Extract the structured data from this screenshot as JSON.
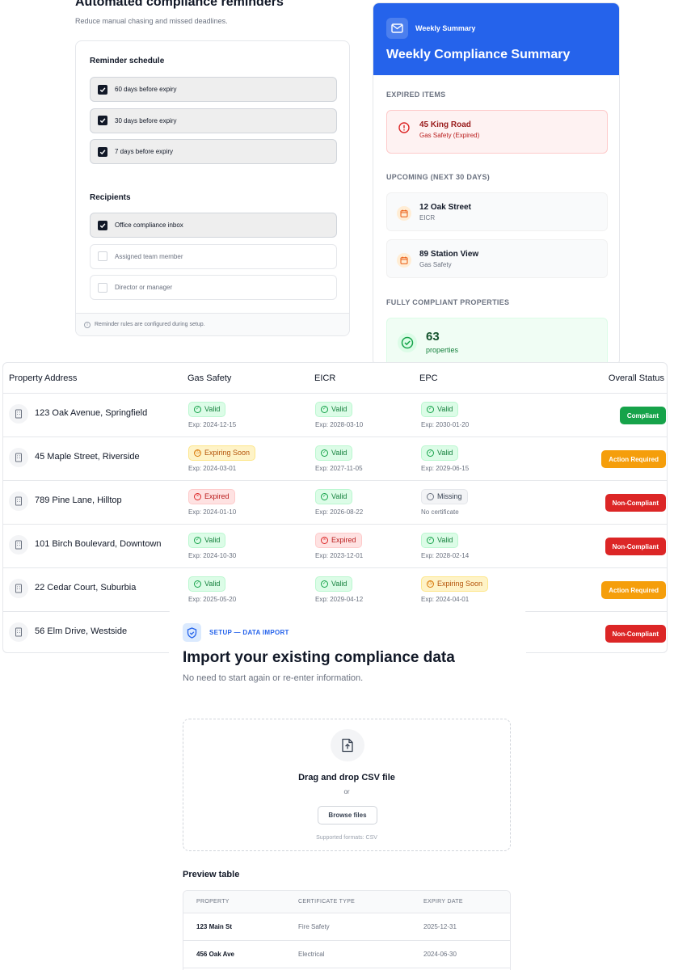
{
  "reminders": {
    "title": "Automated compliance reminders",
    "subtitle": "Reduce manual chasing and missed deadlines.",
    "schedule_heading": "Reminder schedule",
    "schedule": [
      {
        "label": "60 days before expiry",
        "checked": true
      },
      {
        "label": "30 days before expiry",
        "checked": true
      },
      {
        "label": "7 days before expiry",
        "checked": true
      }
    ],
    "recipients_heading": "Recipients",
    "recipients": [
      {
        "label": "Office compliance inbox",
        "checked": true
      },
      {
        "label": "Assigned team member",
        "checked": false
      },
      {
        "label": "Director or manager",
        "checked": false
      }
    ],
    "footer_note": "Reminder rules are configured during setup."
  },
  "summary": {
    "badge_label": "Weekly Summary",
    "title": "Weekly Compliance Summary",
    "accent_color": "#2563eb",
    "expired_heading": "EXPIRED ITEMS",
    "expired": {
      "title": "45 King Road",
      "detail": "Gas Safety (Expired)"
    },
    "upcoming_heading": "UPCOMING (NEXT 30 DAYS)",
    "upcoming": [
      {
        "title": "12 Oak Street",
        "detail": "EICR"
      },
      {
        "title": "89 Station View",
        "detail": "Gas Safety"
      }
    ],
    "compliant_heading": "FULLY COMPLIANT PROPERTIES",
    "compliant_count": "63",
    "compliant_unit": "properties"
  },
  "table": {
    "headers": {
      "address": "Property Address",
      "gas": "Gas Safety",
      "eicr": "EICR",
      "epc": "EPC",
      "status": "Overall Status"
    },
    "rows": [
      {
        "address": "123 Oak Avenue, Springfield",
        "gas": {
          "state": "valid",
          "label": "Valid",
          "exp": "Exp: 2024-12-15"
        },
        "eicr": {
          "state": "valid",
          "label": "Valid",
          "exp": "Exp: 2028-03-10"
        },
        "epc": {
          "state": "valid",
          "label": "Valid",
          "exp": "Exp: 2030-01-20"
        },
        "status": {
          "kind": "compliant",
          "label": "Compliant"
        }
      },
      {
        "address": "45 Maple Street, Riverside",
        "gas": {
          "state": "soon",
          "label": "Expiring Soon",
          "exp": "Exp: 2024-03-01"
        },
        "eicr": {
          "state": "valid",
          "label": "Valid",
          "exp": "Exp: 2027-11-05"
        },
        "epc": {
          "state": "valid",
          "label": "Valid",
          "exp": "Exp: 2029-06-15"
        },
        "status": {
          "kind": "action",
          "label": "Action Required"
        }
      },
      {
        "address": "789 Pine Lane, Hilltop",
        "gas": {
          "state": "expired",
          "label": "Expired",
          "exp": "Exp: 2024-01-10"
        },
        "eicr": {
          "state": "valid",
          "label": "Valid",
          "exp": "Exp: 2026-08-22"
        },
        "epc": {
          "state": "missing",
          "label": "Missing",
          "exp": "No certificate"
        },
        "status": {
          "kind": "non",
          "label": "Non-Compliant"
        }
      },
      {
        "address": "101 Birch Boulevard, Downtown",
        "gas": {
          "state": "valid",
          "label": "Valid",
          "exp": "Exp: 2024-10-30"
        },
        "eicr": {
          "state": "expired",
          "label": "Expired",
          "exp": "Exp: 2023-12-01"
        },
        "epc": {
          "state": "valid",
          "label": "Valid",
          "exp": "Exp: 2028-02-14"
        },
        "status": {
          "kind": "non",
          "label": "Non-Compliant"
        }
      },
      {
        "address": "22 Cedar Court, Suburbia",
        "gas": {
          "state": "valid",
          "label": "Valid",
          "exp": "Exp: 2025-05-20"
        },
        "eicr": {
          "state": "valid",
          "label": "Valid",
          "exp": "Exp: 2029-04-12"
        },
        "epc": {
          "state": "soon",
          "label": "Expiring Soon",
          "exp": "Exp: 2024-04-01"
        },
        "status": {
          "kind": "action",
          "label": "Action Required"
        }
      },
      {
        "address": "56 Elm Drive, Westside",
        "status": {
          "kind": "non",
          "label": "Non-Compliant"
        }
      }
    ]
  },
  "import": {
    "kicker": "SETUP — DATA IMPORT",
    "title": "Import your existing compliance data",
    "subtitle": "No need to start again or re-enter information.",
    "drop_title": "Drag and drop CSV file",
    "drop_or": "or",
    "browse_label": "Browse files",
    "formats": "Supported formats: CSV",
    "preview_heading": "Preview table",
    "preview_headers": {
      "property": "PROPERTY",
      "type": "CERTIFICATE TYPE",
      "expiry": "EXPIRY DATE"
    },
    "preview_rows": [
      {
        "property": "123 Main St",
        "type": "Fire Safety",
        "expiry": "2025-12-31"
      },
      {
        "property": "456 Oak Ave",
        "type": "Electrical",
        "expiry": "2024-06-30"
      }
    ]
  }
}
